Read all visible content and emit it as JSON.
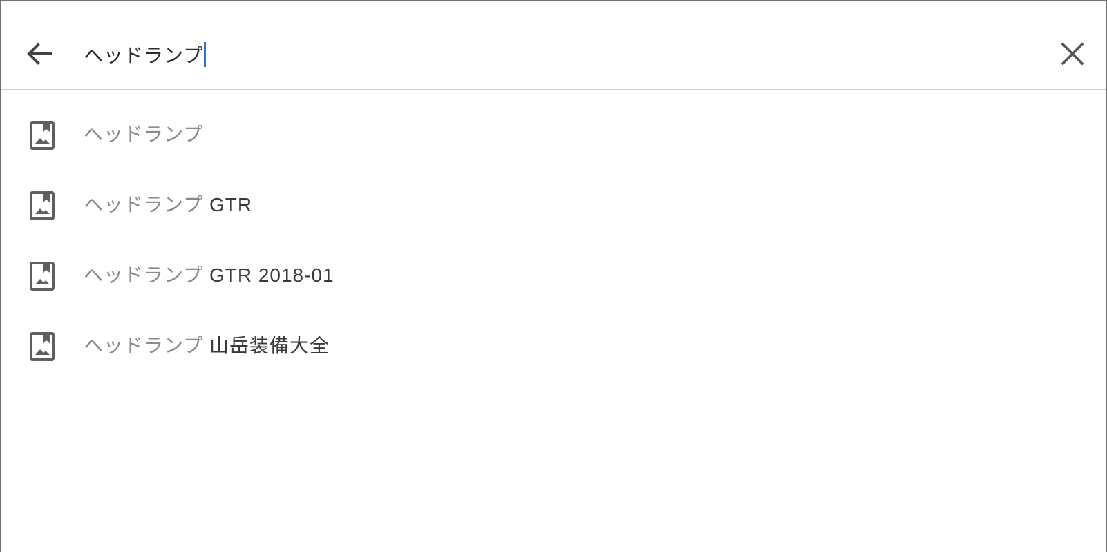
{
  "search": {
    "query": "ヘッドランプ",
    "back_icon": "arrow-left-icon",
    "clear_icon": "close-icon"
  },
  "suggestions": [
    {
      "prefix": "ヘッドランプ",
      "suffix": "",
      "icon": "photo-bookmark-icon"
    },
    {
      "prefix": "ヘッドランプ",
      "suffix": " GTR",
      "icon": "photo-bookmark-icon"
    },
    {
      "prefix": "ヘッドランプ",
      "suffix": " GTR 2018-01",
      "icon": "photo-bookmark-icon"
    },
    {
      "prefix": "ヘッドランプ",
      "suffix": " 山岳装備大全",
      "icon": "photo-bookmark-icon"
    }
  ],
  "colors": {
    "caret": "#2f6fd6",
    "icon": "#5f5f5f",
    "prefix_text": "#8a8a8a",
    "suffix_text": "#3a3a3a"
  }
}
